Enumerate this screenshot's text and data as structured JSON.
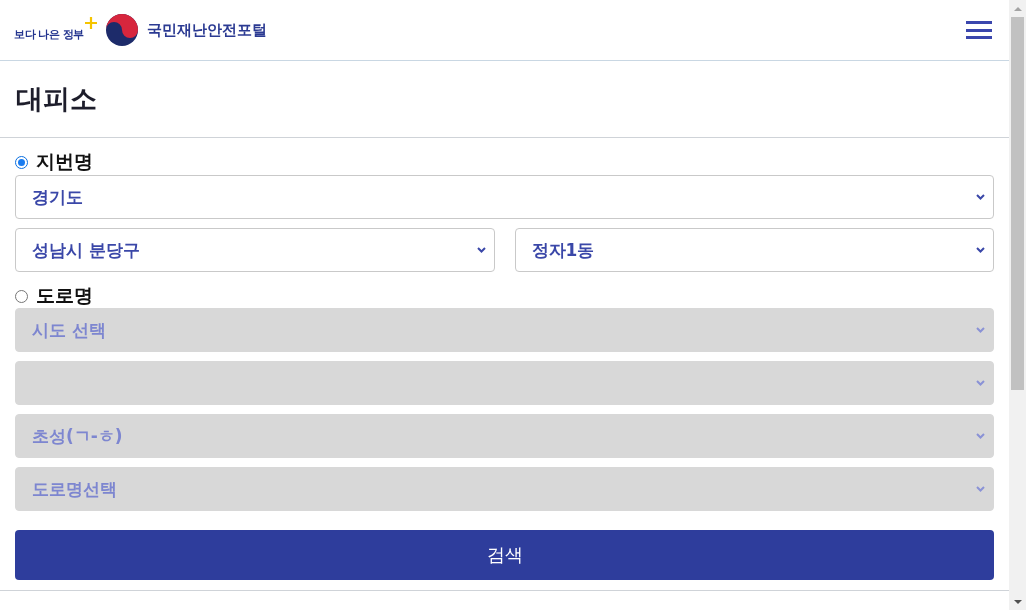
{
  "header": {
    "logo_text": "보다 나은 정부",
    "site_name": "국민재난안전포털"
  },
  "page_title": "대피소",
  "search_modes": [
    {
      "label": "지번명",
      "selected": true,
      "rows": [
        [
          {
            "value": "경기도",
            "disabled": false
          }
        ],
        [
          {
            "value": "성남시 분당구",
            "disabled": false
          },
          {
            "value": "정자1동",
            "disabled": false
          }
        ]
      ]
    },
    {
      "label": "도로명",
      "selected": false,
      "rows": [
        [
          {
            "value": "시도 선택",
            "disabled": true
          }
        ],
        [
          {
            "disabled": true
          }
        ],
        [
          {
            "value": "초성(ㄱ-ㅎ)",
            "disabled": true
          }
        ],
        [
          {
            "value": "도로명선택",
            "disabled": true
          }
        ]
      ]
    }
  ],
  "search_button": "검색"
}
